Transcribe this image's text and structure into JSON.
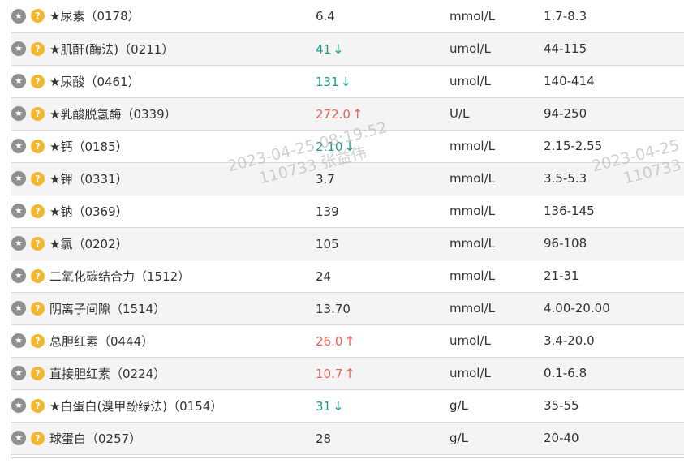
{
  "rows": [
    {
      "star": "★",
      "name": "尿素",
      "code": "（0178）",
      "value": "6.4",
      "flag": "",
      "unit": "mmol/L",
      "ref": "1.7-8.3"
    },
    {
      "star": "★",
      "name": "肌酐(酶法)",
      "code": "（0211）",
      "value": "41",
      "flag": "↓",
      "unit": "umol/L",
      "ref": "44-115"
    },
    {
      "star": "★",
      "name": "尿酸",
      "code": "（0461）",
      "value": "131",
      "flag": "↓",
      "unit": "umol/L",
      "ref": "140-414"
    },
    {
      "star": "★",
      "name": "乳酸脱氢酶",
      "code": "（0339）",
      "value": "272.0",
      "flag": "↑",
      "unit": "U/L",
      "ref": "94-250"
    },
    {
      "star": "★",
      "name": "钙",
      "code": "（0185）",
      "value": "2.10",
      "flag": "↓",
      "unit": "mmol/L",
      "ref": "2.15-2.55"
    },
    {
      "star": "★",
      "name": "钾",
      "code": "（0331）",
      "value": "3.7",
      "flag": "",
      "unit": "mmol/L",
      "ref": "3.5-5.3"
    },
    {
      "star": "★",
      "name": "钠",
      "code": "（0369）",
      "value": "139",
      "flag": "",
      "unit": "mmol/L",
      "ref": "136-145"
    },
    {
      "star": "★",
      "name": "氯",
      "code": "（0202）",
      "value": "105",
      "flag": "",
      "unit": "mmol/L",
      "ref": "96-108"
    },
    {
      "star": "",
      "name": "二氧化碳结合力",
      "code": "（1512）",
      "value": "24",
      "flag": "",
      "unit": "mmol/L",
      "ref": "21-31"
    },
    {
      "star": "",
      "name": "阴离子间隙",
      "code": "（1514）",
      "value": "13.70",
      "flag": "",
      "unit": "mmol/L",
      "ref": "4.00-20.00"
    },
    {
      "star": "",
      "name": "总胆红素",
      "code": "（0444）",
      "value": "26.0",
      "flag": "↑",
      "unit": "umol/L",
      "ref": "3.4-20.0"
    },
    {
      "star": "",
      "name": "直接胆红素",
      "code": "（0224）",
      "value": "10.7",
      "flag": "↑",
      "unit": "umol/L",
      "ref": "0.1-6.8"
    },
    {
      "star": "★",
      "name": "白蛋白(溴甲酚绿法)",
      "code": "（0154）",
      "value": "31",
      "flag": "↓",
      "unit": "g/L",
      "ref": "35-55"
    },
    {
      "star": "",
      "name": "球蛋白",
      "code": "（0257）",
      "value": "28",
      "flag": "",
      "unit": "g/L",
      "ref": "20-40"
    }
  ],
  "icons": {
    "star_glyph": "★",
    "help_glyph": "?"
  },
  "watermarks": [
    {
      "line1": "2023-04-25 08:19:52",
      "line2": "110733 张益伟"
    },
    {
      "line1": "2023-04-25 0",
      "line2": "110733 张"
    }
  ],
  "colors": {
    "low": "#1e9a8a",
    "high": "#e8655a",
    "help_icon": "#f3b62f",
    "star_icon": "#8f8f8f"
  }
}
